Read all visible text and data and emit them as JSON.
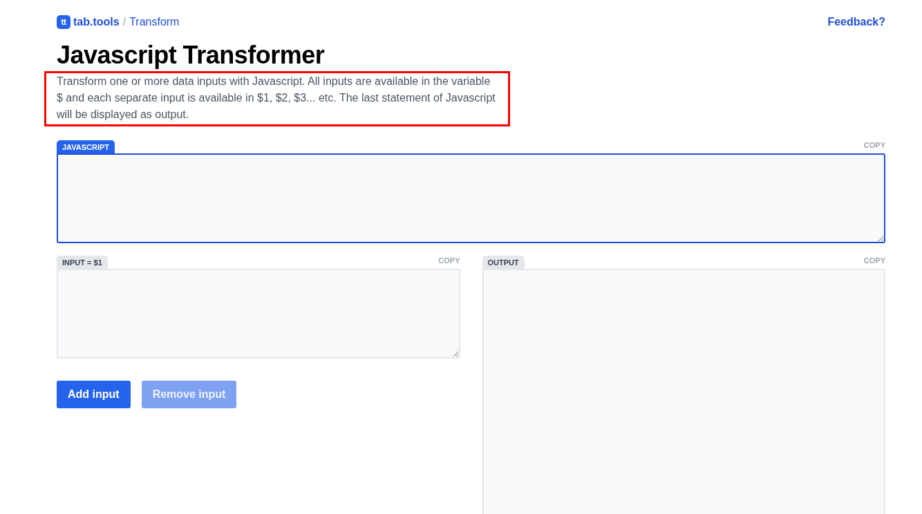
{
  "header": {
    "logo_mark": "tt",
    "site": "tab.tools",
    "separator": "/",
    "page": "Transform",
    "feedback": "Feedback?"
  },
  "title": "Javascript Transformer",
  "description": {
    "text": "Transform one or more data inputs with Javascript. All inputs are available in the variable $ and each separate input is available in $1, $2, $3... etc. The last statement of Javascript will be displayed as output.",
    "highlighted": true
  },
  "editor": {
    "label": "JAVASCRIPT",
    "copy": "COPY",
    "focused": true
  },
  "inputs": [
    {
      "label": "INPUT = $1",
      "copy": "COPY",
      "focused": false
    }
  ],
  "buttons": [
    {
      "label": "Add input",
      "disabled": false
    },
    {
      "label": "Remove input",
      "disabled": true
    }
  ],
  "output": {
    "label": "OUTPUT",
    "copy": "COPY",
    "focused": false
  }
}
